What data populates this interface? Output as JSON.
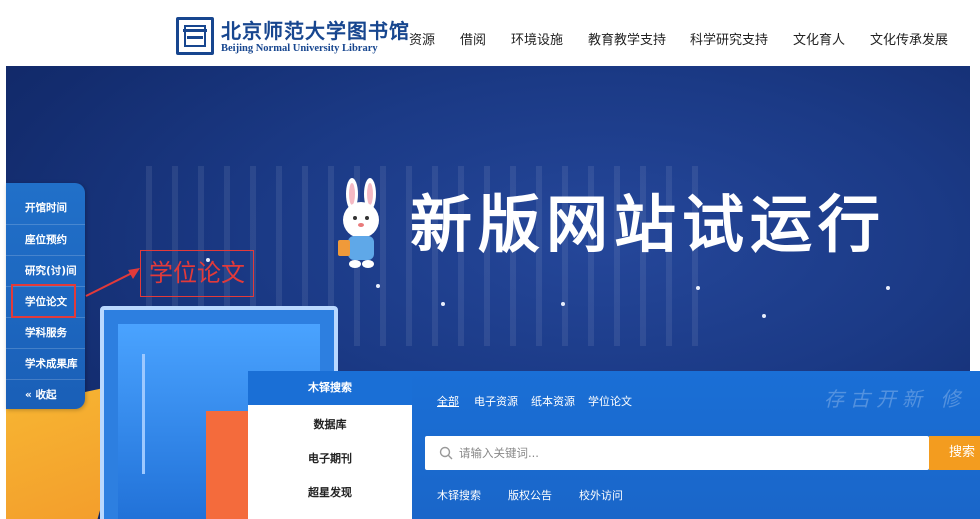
{
  "header": {
    "logo_cn": "北京师范大学图书馆",
    "logo_en": "Beijing Normal University Library",
    "nav": [
      "资源",
      "借阅",
      "环境设施",
      "教育教学支持",
      "科学研究支持",
      "文化育人",
      "文化传承发展"
    ]
  },
  "banner": {
    "slogan": "新版网站试运行"
  },
  "sidebar": {
    "items": [
      "开馆时间",
      "座位预约",
      "研究(讨)间",
      "学位论文",
      "学科服务",
      "学术成果库",
      "« 收起"
    ],
    "highlighted": "学位论文"
  },
  "callout": {
    "label": "学位论文",
    "color": "#e23a3a"
  },
  "search": {
    "tabs": [
      "木铎搜索",
      "数据库",
      "电子期刊",
      "超星发现"
    ],
    "active_tab": "木铎搜索",
    "filters": [
      "全部",
      "电子资源",
      "纸本资源",
      "学位论文"
    ],
    "active_filter": "全部",
    "watermark": "存古开新 修",
    "placeholder": "请输入关键词...",
    "button": "搜索",
    "quick_links": [
      "木铎搜索",
      "版权公告",
      "校外访问"
    ]
  },
  "colors": {
    "brand_blue": "#17468f",
    "panel_blue": "#1a6fd6",
    "search_orange": "#f39c1f",
    "banner_navy": "#1b3a86"
  }
}
